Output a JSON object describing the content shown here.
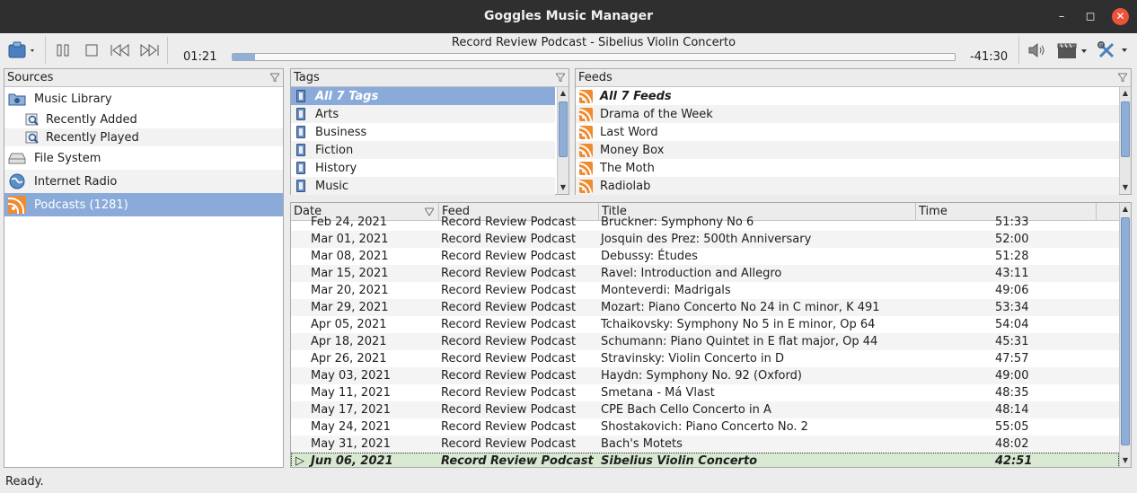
{
  "window": {
    "title": "Goggles Music Manager"
  },
  "player": {
    "now_playing": "Record Review Podcast - Sibelius Violin Concerto",
    "elapsed": "01:21",
    "remaining": "-41:30",
    "progress_fraction": 0.031
  },
  "sources": {
    "header": "Sources",
    "items": [
      {
        "label": "Music Library",
        "icon": "library-icon"
      },
      {
        "label": "Recently Added",
        "icon": "search-playlist-icon"
      },
      {
        "label": "Recently Played",
        "icon": "search-playlist-icon"
      },
      {
        "label": "File System",
        "icon": "drive-icon"
      },
      {
        "label": "Internet Radio",
        "icon": "globe-icon"
      },
      {
        "label": "Podcasts (1281)",
        "icon": "rss-icon"
      }
    ]
  },
  "tags": {
    "header": "Tags",
    "items": [
      "All 7 Tags",
      "Arts",
      "Business",
      "Fiction",
      "History",
      "Music"
    ]
  },
  "feeds": {
    "header": "Feeds",
    "items": [
      "All 7 Feeds",
      "Drama of the Week",
      "Last Word",
      "Money Box",
      "The Moth",
      "Radiolab"
    ]
  },
  "episodes": {
    "columns": {
      "date": "Date",
      "feed": "Feed",
      "title": "Title",
      "time": "Time"
    },
    "rows": [
      {
        "date": "Feb 24, 2021",
        "feed": "Record Review Podcast",
        "title": "Bruckner: Symphony No 6",
        "time": "51:33"
      },
      {
        "date": "Mar 01, 2021",
        "feed": "Record Review Podcast",
        "title": "Josquin des Prez: 500th Anniversary",
        "time": "52:00"
      },
      {
        "date": "Mar 08, 2021",
        "feed": "Record Review Podcast",
        "title": "Debussy: Études",
        "time": "51:28"
      },
      {
        "date": "Mar 15, 2021",
        "feed": "Record Review Podcast",
        "title": "Ravel: Introduction and Allegro",
        "time": "43:11"
      },
      {
        "date": "Mar 20, 2021",
        "feed": "Record Review Podcast",
        "title": "Monteverdi: Madrigals",
        "time": "49:06"
      },
      {
        "date": "Mar 29, 2021",
        "feed": "Record Review Podcast",
        "title": "Mozart: Piano Concerto No 24 in C minor, K 491",
        "time": "53:34"
      },
      {
        "date": "Apr 05, 2021",
        "feed": "Record Review Podcast",
        "title": "Tchaikovsky: Symphony No 5 in E minor, Op 64",
        "time": "54:04"
      },
      {
        "date": "Apr 18, 2021",
        "feed": "Record Review Podcast",
        "title": "Schumann: Piano Quintet in E flat major, Op 44",
        "time": "45:31"
      },
      {
        "date": "Apr 26, 2021",
        "feed": "Record Review Podcast",
        "title": "Stravinsky: Violin Concerto in D",
        "time": "47:57"
      },
      {
        "date": "May 03, 2021",
        "feed": "Record Review Podcast",
        "title": "Haydn: Symphony No. 92 (Oxford)",
        "time": "49:00"
      },
      {
        "date": "May 11, 2021",
        "feed": "Record Review Podcast",
        "title": "Smetana - Má Vlast",
        "time": "48:35"
      },
      {
        "date": "May 17, 2021",
        "feed": "Record Review Podcast",
        "title": "CPE Bach Cello Concerto in A",
        "time": "48:14"
      },
      {
        "date": "May 24, 2021",
        "feed": "Record Review Podcast",
        "title": "Shostakovich: Piano Concerto No. 2",
        "time": "55:05"
      },
      {
        "date": "May 31, 2021",
        "feed": "Record Review Podcast",
        "title": "Bach's Motets",
        "time": "48:02"
      },
      {
        "date": "Jun 06, 2021",
        "feed": "Record Review Podcast",
        "title": "Sibelius Violin Concerto",
        "time": "42:51"
      }
    ]
  },
  "status": {
    "text": "Ready."
  },
  "colors": {
    "selection": "#8aabd9",
    "playing_row": "#d7e9d0",
    "rss": "#ef8a2f",
    "titlebar": "#2f2f2f"
  }
}
